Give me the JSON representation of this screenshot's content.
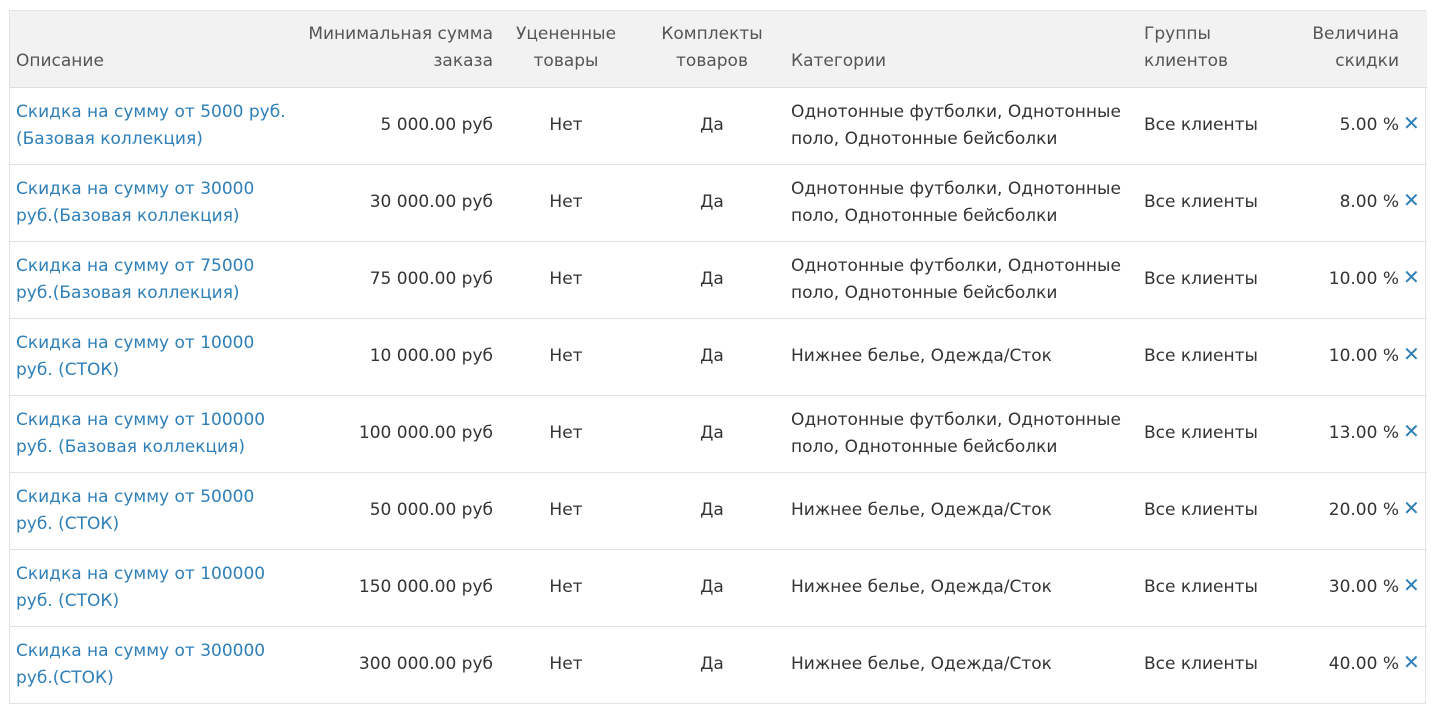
{
  "headers": {
    "description": "Описание",
    "min_amount": "Минимальная сумма заказа",
    "discounted": "Уцененные товары",
    "kits": "Комплекты товаров",
    "categories": "Категории",
    "client_groups": "Группы клиентов",
    "discount_value": "Величина скидки"
  },
  "delete_icon": "close-icon",
  "colors": {
    "link": "#2f7fb8",
    "header_bg": "#f2f2f2"
  },
  "rows": [
    {
      "description": "Скидка на сумму от 5000 руб. (Базовая коллекция)",
      "min_amount": "5 000.00 руб",
      "discounted": "Нет",
      "kits": "Да",
      "categories": "Однотонные футболки, Однотонные поло, Однотонные бейсболки",
      "client_groups": "Все клиенты",
      "discount_value": "5.00 %",
      "delete_glyph": "✕"
    },
    {
      "description": "Скидка на сумму от 30000 руб.(Базовая коллекция)",
      "min_amount": "30 000.00 руб",
      "discounted": "Нет",
      "kits": "Да",
      "categories": "Однотонные футболки, Однотонные поло, Однотонные бейсболки",
      "client_groups": "Все клиенты",
      "discount_value": "8.00 %",
      "delete_glyph": "✕"
    },
    {
      "description": "Скидка на сумму от 75000 руб.(Базовая коллекция)",
      "min_amount": "75 000.00 руб",
      "discounted": "Нет",
      "kits": "Да",
      "categories": "Однотонные футболки, Однотонные поло, Однотонные бейсболки",
      "client_groups": "Все клиенты",
      "discount_value": "10.00 %",
      "delete_glyph": "✕"
    },
    {
      "description": "Скидка на сумму от 10000 руб. (СТОК)",
      "min_amount": "10 000.00 руб",
      "discounted": "Нет",
      "kits": "Да",
      "categories": "Нижнее белье, Одежда/Сток",
      "client_groups": "Все клиенты",
      "discount_value": "10.00 %",
      "delete_glyph": "✕"
    },
    {
      "description": "Скидка на сумму от 100000 руб. (Базовая коллекция)",
      "min_amount": "100 000.00 руб",
      "discounted": "Нет",
      "kits": "Да",
      "categories": "Однотонные футболки, Однотонные поло, Однотонные бейсболки",
      "client_groups": "Все клиенты",
      "discount_value": "13.00 %",
      "delete_glyph": "✕"
    },
    {
      "description": "Скидка на сумму от 50000 руб. (СТОК)",
      "min_amount": "50 000.00 руб",
      "discounted": "Нет",
      "kits": "Да",
      "categories": "Нижнее белье, Одежда/Сток",
      "client_groups": "Все клиенты",
      "discount_value": "20.00 %",
      "delete_glyph": "✕"
    },
    {
      "description": "Скидка на сумму от 100000 руб. (СТОК)",
      "min_amount": "150 000.00 руб",
      "discounted": "Нет",
      "kits": "Да",
      "categories": "Нижнее белье, Одежда/Сток",
      "client_groups": "Все клиенты",
      "discount_value": "30.00 %",
      "delete_glyph": "✕"
    },
    {
      "description": "Скидка на сумму от 300000 руб.(СТОК)",
      "min_amount": "300 000.00 руб",
      "discounted": "Нет",
      "kits": "Да",
      "categories": "Нижнее белье, Одежда/Сток",
      "client_groups": "Все клиенты",
      "discount_value": "40.00 %",
      "delete_glyph": "✕"
    }
  ]
}
